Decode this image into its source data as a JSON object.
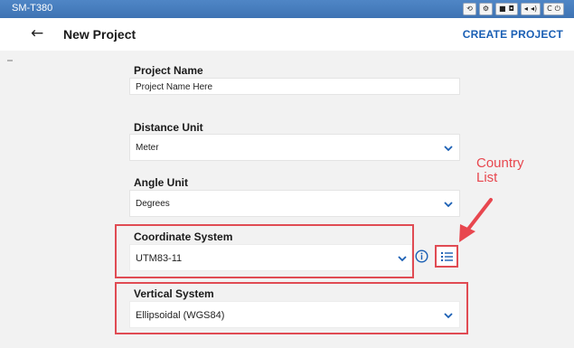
{
  "device": {
    "name": "SM-T380",
    "toolbar_icons": [
      "rotate-icon",
      "settings-icon",
      "record-icon",
      "camera-icon",
      "volume-down-icon",
      "volume-up-icon",
      "back-icon",
      "power-icon"
    ]
  },
  "header": {
    "back_icon": "arrow-left-icon",
    "title": "New Project",
    "action": "CREATE PROJECT"
  },
  "form": {
    "project_name": {
      "label": "Project Name",
      "value": "Project Name Here"
    },
    "distance_unit": {
      "label": "Distance Unit",
      "value": "Meter"
    },
    "angle_unit": {
      "label": "Angle Unit",
      "value": "Degrees"
    },
    "coordinate_system": {
      "label": "Coordinate System",
      "value": "UTM83-11"
    },
    "vertical_system": {
      "label": "Vertical System",
      "value": "Ellipsoidal (WGS84)"
    }
  },
  "annotation": {
    "line1": "Country",
    "line2": "List",
    "color": "#e8474f"
  },
  "colors": {
    "accent": "#1a5fb4",
    "highlight": "#e04b53",
    "topbar": "#4678bc"
  }
}
